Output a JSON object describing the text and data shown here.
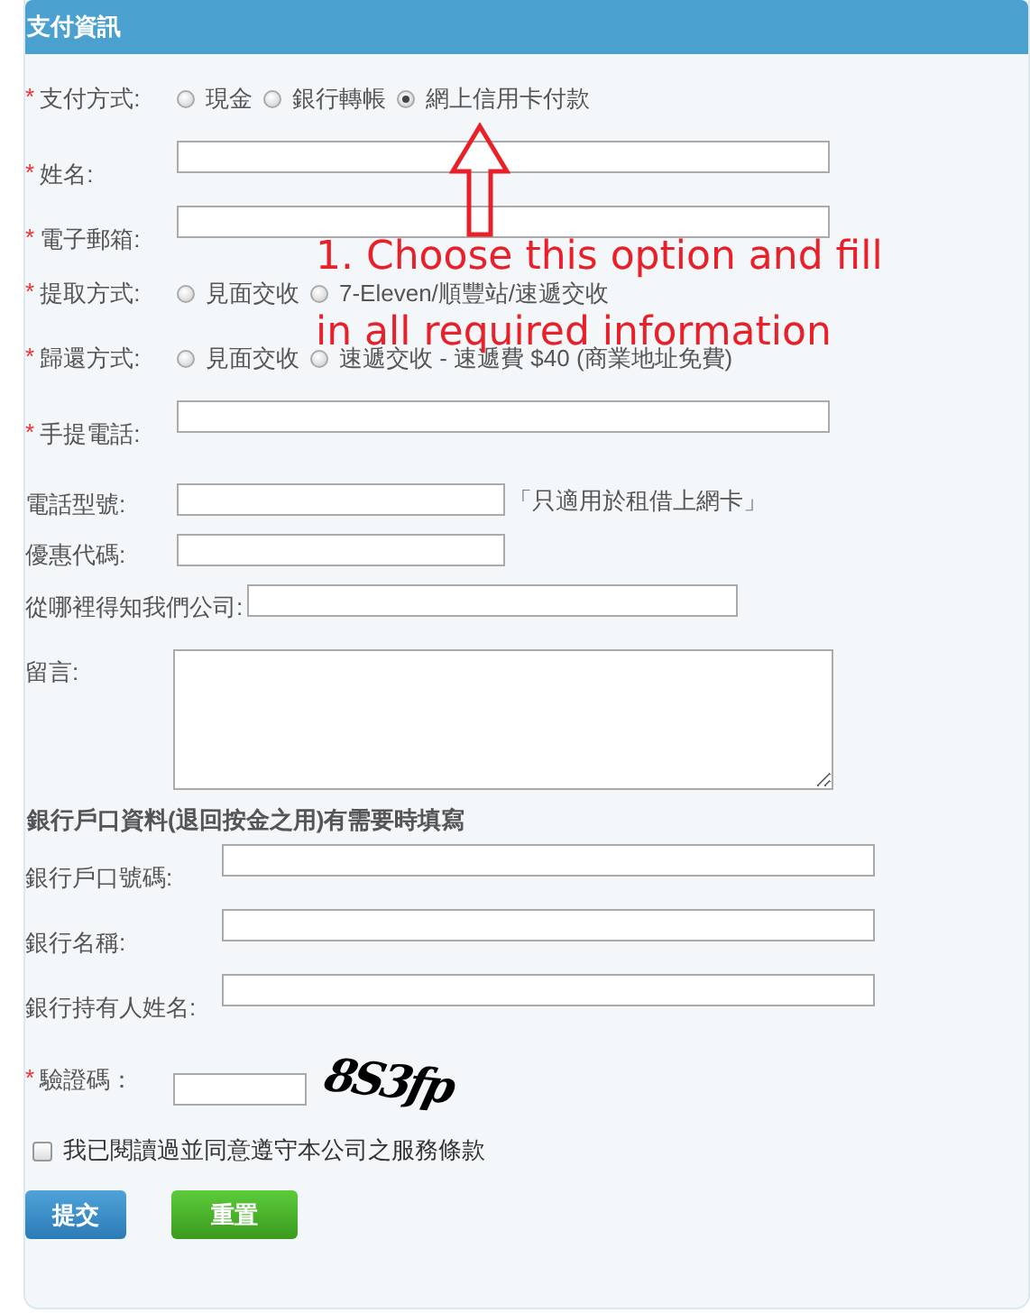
{
  "header": {
    "title": "支付資訊"
  },
  "fields": [
    {
      "kind": "radio",
      "star": "*",
      "label": "支付方式:",
      "options": [
        {
          "label": "現金",
          "selected": false
        },
        {
          "label": "銀行轉帳",
          "selected": false
        },
        {
          "label": "網上信用卡付款",
          "selected": true
        }
      ]
    },
    {
      "kind": "text",
      "star": "*",
      "label": "姓名:"
    },
    {
      "kind": "text",
      "star": "*",
      "label": "電子郵箱:"
    },
    {
      "kind": "radio",
      "star": "*",
      "label": "提取方式:",
      "options": [
        {
          "label": "見面交收",
          "selected": false
        },
        {
          "label": "7-Eleven/順豐站/速遞交收",
          "selected": false
        }
      ]
    },
    {
      "kind": "radio",
      "star": "*",
      "label": "歸還方式:",
      "options": [
        {
          "label": "見面交收",
          "selected": false
        },
        {
          "label": "速遞交收 - 速遞費 $40 (商業地址免費)",
          "selected": false
        }
      ]
    },
    {
      "kind": "text",
      "star": "*",
      "label": "手提電話:"
    },
    {
      "kind": "short",
      "label": "電話型號:",
      "note": "「只適用於租借上網卡」"
    },
    {
      "kind": "short",
      "label": "優惠代碼:"
    },
    {
      "kind": "medium",
      "label": "從哪裡得知我們公司:"
    },
    {
      "kind": "textarea",
      "label": "留言:"
    }
  ],
  "bank_section": {
    "title": "銀行戶口資料(退回按金之用)有需要時填寫",
    "fields": [
      {
        "kind": "text",
        "label": "銀行戶口號碼:"
      },
      {
        "kind": "text",
        "label": "銀行名稱:"
      },
      {
        "kind": "text",
        "label": "銀行持有人姓名:"
      }
    ]
  },
  "captcha": {
    "star": "*",
    "label": "驗證碼：",
    "code": "8S3fp"
  },
  "terms": {
    "label": "我已閱讀過並同意遵守本公司之服務條款",
    "checked": false
  },
  "buttons": [
    {
      "kind": "submit",
      "label": "提交"
    },
    {
      "kind": "reset",
      "label": "重置"
    }
  ],
  "annotation": {
    "lines": [
      "1. Choose this option and fill",
      "in all required information"
    ]
  }
}
